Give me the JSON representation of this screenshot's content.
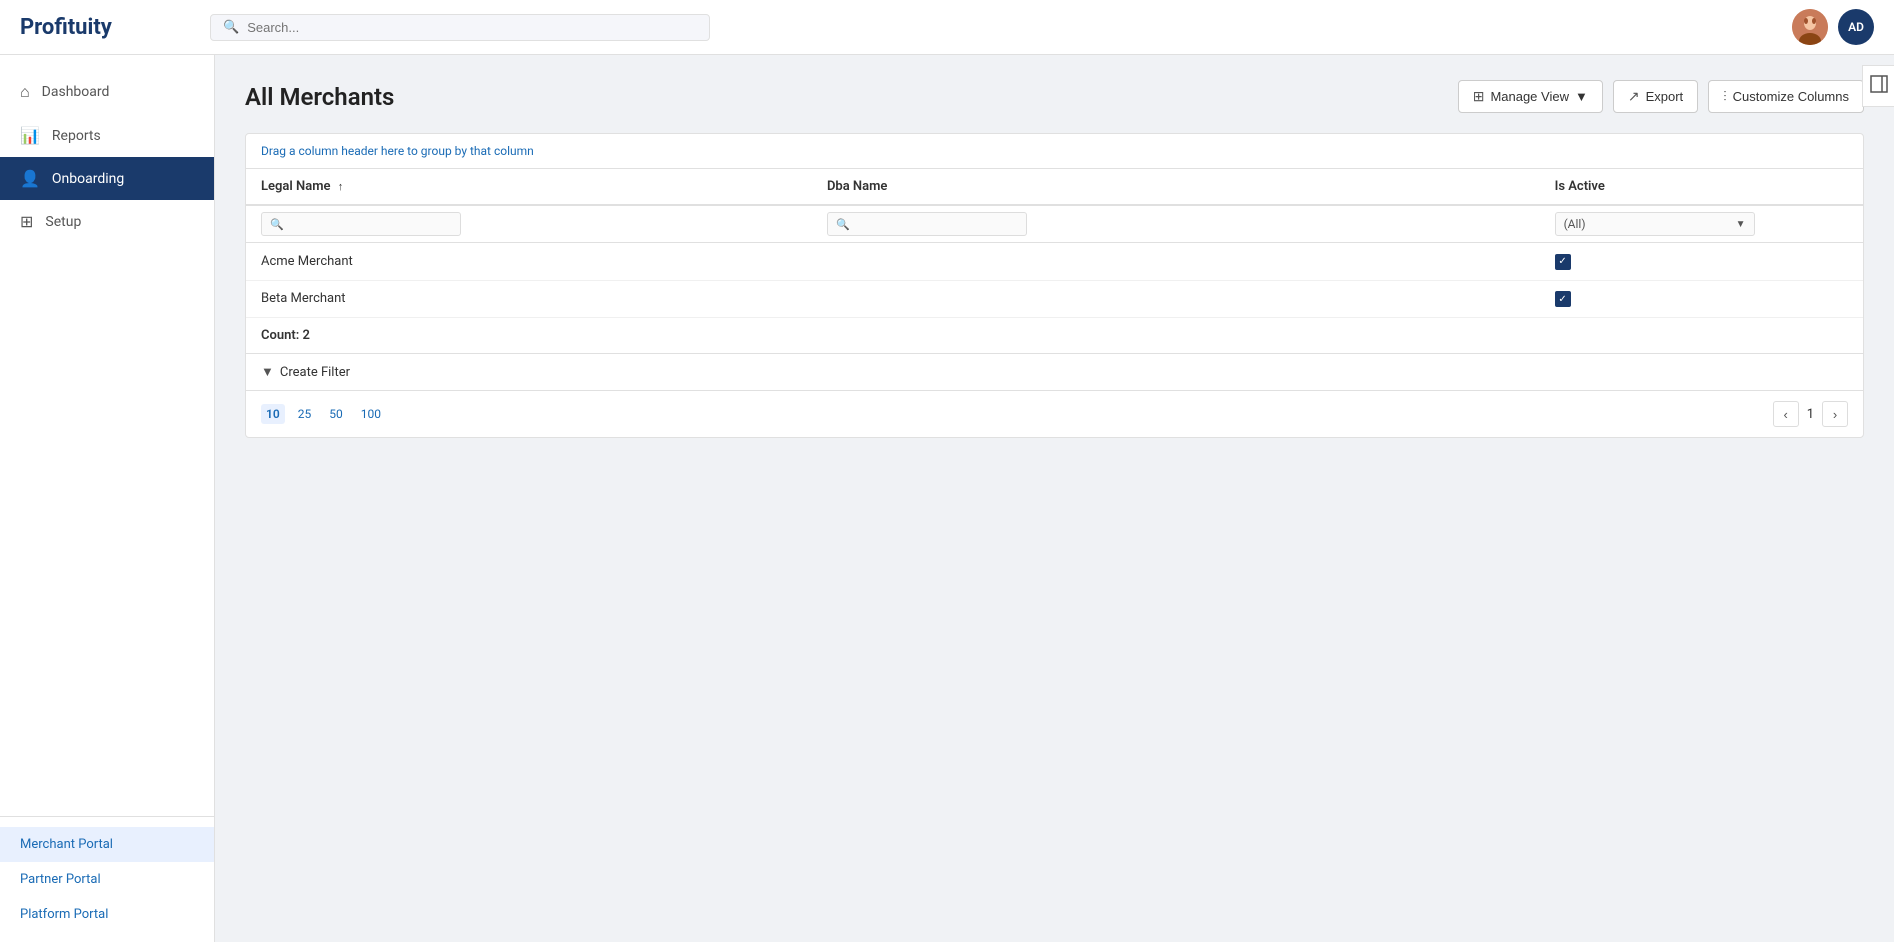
{
  "header": {
    "logo": "Profituity",
    "search_placeholder": "Search...",
    "user_initials": "AD"
  },
  "sidebar": {
    "items": [
      {
        "id": "dashboard",
        "label": "Dashboard",
        "icon": "⌂",
        "active": false
      },
      {
        "id": "reports",
        "label": "Reports",
        "icon": "📊",
        "active": false
      },
      {
        "id": "onboarding",
        "label": "Onboarding",
        "icon": "👤",
        "active": true
      },
      {
        "id": "setup",
        "label": "Setup",
        "icon": "⊞",
        "active": false
      }
    ],
    "portals": [
      {
        "id": "merchant-portal",
        "label": "Merchant Portal",
        "active": true
      },
      {
        "id": "partner-portal",
        "label": "Partner Portal",
        "active": false
      },
      {
        "id": "platform-portal",
        "label": "Platform Portal",
        "active": false
      }
    ]
  },
  "main": {
    "page_title": "All Merchants",
    "toolbar": {
      "manage_view_label": "Manage View",
      "export_label": "Export",
      "customize_columns_label": "Customize Columns"
    },
    "drag_hint": "Drag a column header here to group by that column",
    "table": {
      "columns": [
        {
          "id": "legal_name",
          "label": "Legal Name",
          "sortable": true
        },
        {
          "id": "dba_name",
          "label": "Dba Name",
          "sortable": false
        },
        {
          "id": "is_active",
          "label": "Is Active",
          "sortable": false
        }
      ],
      "filter_all_option": "(All)",
      "rows": [
        {
          "legal_name": "Acme Merchant",
          "dba_name": "",
          "is_active": true
        },
        {
          "legal_name": "Beta Merchant",
          "dba_name": "",
          "is_active": true
        }
      ]
    },
    "count_label": "Count: 2",
    "create_filter_label": "Create Filter",
    "pagination": {
      "page_sizes": [
        "10",
        "25",
        "50",
        "100"
      ],
      "active_page_size": "10",
      "current_page": "1"
    }
  }
}
